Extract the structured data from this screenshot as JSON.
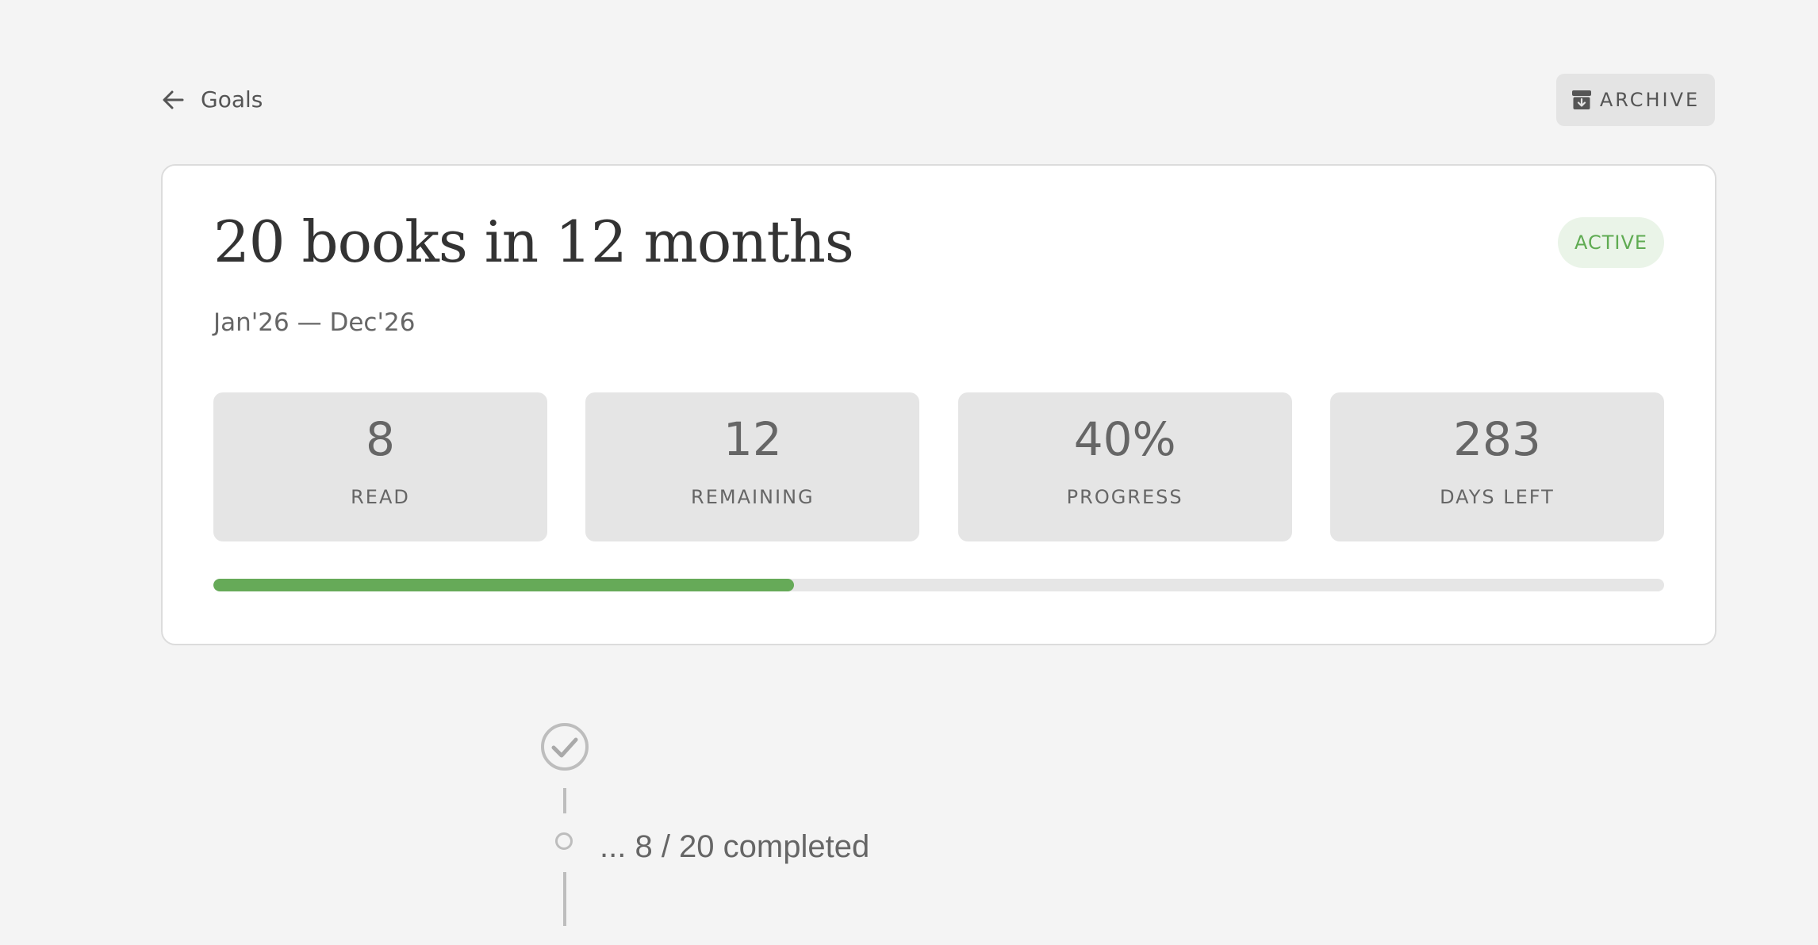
{
  "nav": {
    "back_label": "Goals",
    "archive_label": "ARCHIVE"
  },
  "goal": {
    "title": "20 books in 12 months",
    "dates": "Jan'26 — Dec'26",
    "status": "ACTIVE",
    "progress_fraction": 0.4
  },
  "stats": [
    {
      "value": "8",
      "label": "READ"
    },
    {
      "value": "12",
      "label": "REMAINING"
    },
    {
      "value": "40%",
      "label": "PROGRESS"
    },
    {
      "value": "283",
      "label": "DAYS LEFT"
    }
  ],
  "timeline": {
    "completed_text": "... 8 / 20 completed"
  },
  "colors": {
    "accent_green": "#66aa58",
    "status_green": "#5fab52",
    "badge_bg": "#eaf4e8",
    "background": "#f4f4f4"
  },
  "icons": {
    "back": "arrow-left-icon",
    "archive": "archive-box-icon",
    "milestone": "check-circle-icon"
  }
}
